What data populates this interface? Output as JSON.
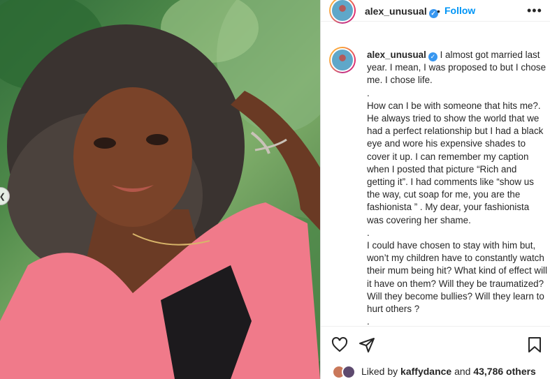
{
  "post": {
    "username": "alex_unusual",
    "follow_label": "Follow",
    "separator": "•",
    "more_label": "•••",
    "photo_alt": "selfie photo"
  },
  "caption": {
    "username": "alex_unusual",
    "lines": [
      "I almost got married last year. I mean, I was proposed to but I chose me. I chose life.",
      ".",
      "How can I be with someone that hits me?. He always tried to show the world that we had a perfect relationship but I had a black eye and wore his expensive shades to cover it up. I can remember my caption when I posted that picture “Rich and getting it”. I had comments like “show us the way, cut soap for me, you are the fashionista ” . My dear, your fashionista was covering her shame.",
      ".",
      "I could have chosen to stay with him but, won’t my children have to constantly watch their mum being hit? What kind of effect will it have on them? Will they be traumatized? Will they become bullies? Will they learn to hurt others ?",
      "."
    ]
  },
  "likes": {
    "prefix": "Liked by",
    "user": "kaffydance",
    "conjunction": "and",
    "count": "43,786 others"
  },
  "icons": {
    "verified": "verified-badge-icon",
    "like": "heart-icon",
    "share": "send-icon",
    "save": "bookmark-icon",
    "prev": "chevron-left-icon"
  },
  "colors": {
    "accent": "#0095f6",
    "verified": "#3897f0",
    "text": "#262626"
  }
}
